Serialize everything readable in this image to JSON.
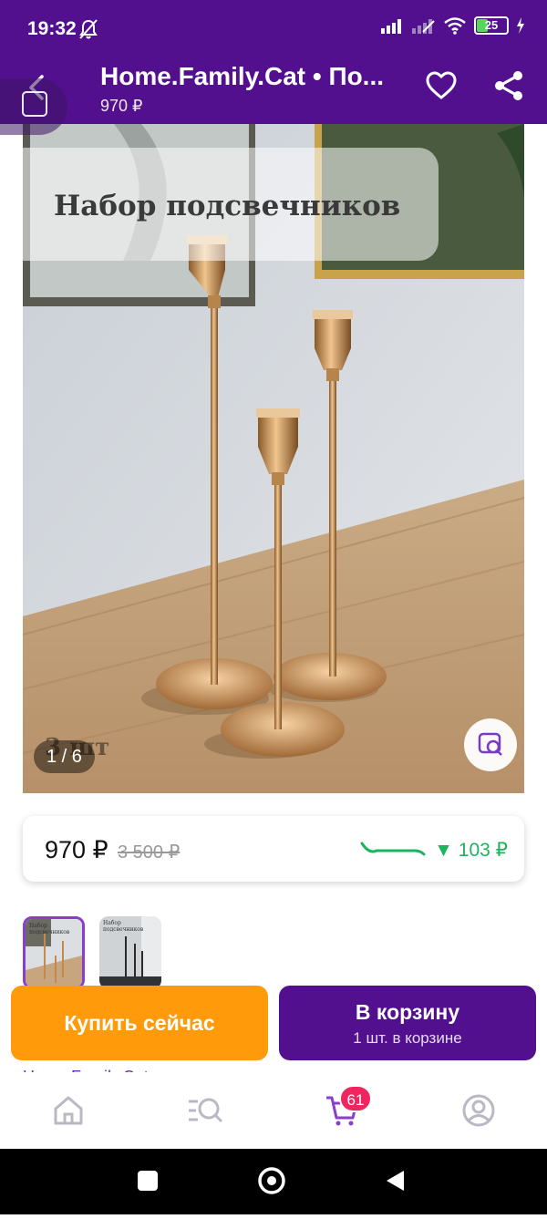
{
  "status_bar": {
    "time": "19:32",
    "battery": "25"
  },
  "header": {
    "title": "Home.Family.Cat • По...",
    "price": "970 ₽"
  },
  "gallery": {
    "overlay_title": "Набор подсвечников",
    "overlay_badge": "3 шт",
    "counter": "1 / 6"
  },
  "price": {
    "current": "970 ₽",
    "old": "3 500 ₽",
    "drop": "▼ 103 ₽"
  },
  "thumbs": [
    {
      "label": "Набор подсвечников"
    },
    {
      "label": "Набор подсвечников"
    }
  ],
  "actions": {
    "buy_now": "Купить сейчас",
    "to_cart": "В корзину",
    "to_cart_sub": "1 шт. в корзине"
  },
  "peek_text": "Home.Family.Cat",
  "tabbar": {
    "cart_count": "61"
  },
  "colors": {
    "brand": "#52108f",
    "accent_orange": "#ff9a0a",
    "badge": "#f0255f",
    "drop_green": "#1cb55e"
  }
}
